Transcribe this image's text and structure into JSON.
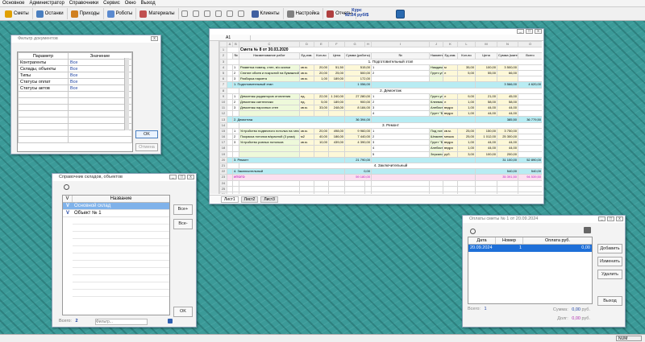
{
  "menu": [
    "Основное",
    "Администратор",
    "Справочники",
    "Сервис",
    "Окно",
    "Выход"
  ],
  "toolbar": [
    {
      "label": "Сметы",
      "icon": "star-icon",
      "color": "#e0a000"
    },
    {
      "label": "Останки",
      "icon": "table-icon",
      "color": "#4a7fc0"
    },
    {
      "label": "Приходы",
      "icon": "truck-icon",
      "color": "#d08020"
    },
    {
      "label": "Роботы",
      "icon": "robot-icon",
      "color": "#5a8ad0"
    },
    {
      "label": "Материалы",
      "icon": "palette-icon",
      "color": "#c05050"
    },
    {
      "label": "Клиенты",
      "icon": "clients-icon",
      "color": "#4060a0"
    },
    {
      "label": "Настройка",
      "icon": "tools-icon",
      "color": "#808080"
    },
    {
      "label": "Отчеты",
      "icon": "report-icon",
      "color": "#b04040"
    }
  ],
  "toolbar_small": [
    "cut-icon",
    "copy-icon",
    "paste-icon",
    "undo-icon",
    "redo-icon",
    "refresh-icon"
  ],
  "course": {
    "line1": "Курс",
    "line2": "92.24 руб/$"
  },
  "status": {
    "cell": "NUM"
  },
  "filter": {
    "title": "Фильтр документов",
    "headers": [
      "Параметр",
      "Значение"
    ],
    "rows": [
      [
        "Контрагенты",
        "Все"
      ],
      [
        "Склады, объекты",
        "Все"
      ],
      [
        "Типы",
        "Все"
      ],
      [
        "Статусы оплат",
        "Все"
      ],
      [
        "Статусы актов",
        "Все"
      ]
    ],
    "ok": "OK",
    "cancel": "Отмена"
  },
  "warehouses": {
    "title": "Справочник складов, объектов",
    "header_check": "V",
    "header_name": "Название",
    "rows": [
      {
        "check": "V",
        "name": "Основной склад",
        "selected": true
      },
      {
        "check": "V",
        "name": "Объект № 1",
        "selected": false
      }
    ],
    "btn_all_on": "Все+",
    "btn_all_off": "Все-",
    "btn_ok": "OK",
    "footer_label": "Всего:",
    "footer_count": "2",
    "search_placeholder": "Фильтр..."
  },
  "sheet": {
    "cell_ref": "A1",
    "col_letters": [
      "A",
      "B",
      "C",
      "D",
      "E",
      "F",
      "G",
      "H",
      "I",
      "J",
      "K",
      "L",
      "M",
      "N",
      "O"
    ],
    "title": "Смета № 8 от 30.03.2020",
    "headers": [
      "№",
      "Наименование работ",
      "Ед.изм.",
      "Кол-во",
      "Цена",
      "Сумма (работы)",
      "№",
      "Наименование материала",
      "Ед.изм.",
      "Кол-во",
      "Цена",
      "Сумма (материалы)",
      "Всего"
    ],
    "sections": [
      {
        "name": "1. Подготовительный этап",
        "rows": [
          [
            "1",
            "Разметка помещ. стен, в/з сколки",
            "кв.м.",
            "20,00",
            "51,50",
            "515,00",
            "1",
            "Наждачная бумага",
            "м",
            "35,00",
            "100,00",
            "3 500,00"
          ],
          [
            "2",
            "Снятие обоев и покрытий на бумажной основе",
            "кв.м.",
            "20,00",
            "25,00",
            "500,00",
            "2",
            "Грунт-универсал \"Кнауф Тифенгрунд\" (10л)",
            "л",
            "5,00",
            "55,00",
            "66,00"
          ],
          [
            "3",
            "Разборка паркета",
            "кв.м.",
            "1,00",
            "189,00",
            "172,00",
            "",
            "",
            "",
            "",
            "",
            ""
          ]
        ],
        "total": [
          "1. Подготовительный этап",
          "1 056,00",
          "3 566,00",
          "4 620,00"
        ]
      },
      {
        "name": "2. Демонтаж",
        "rows": [
          [
            "1",
            "Демонтаж радиаторов отопления",
            "ед.",
            "22,00",
            "1 240,00",
            "27 280,00",
            "1",
            "Грунт-универсал \"Кнауф Тифенгрунд\" (10л)",
            "л",
            "9,00",
            "21,00",
            "45,00"
          ],
          [
            "2",
            "Демонтаж сантехники",
            "ед.",
            "5,00",
            "189,00",
            "900,00",
            "2",
            "Клеевая побелка (в/д) \"Byfe Wandweiss\"",
            "л",
            "1,00",
            "58,00",
            "58,00"
          ],
          [
            "3",
            "Демонтаж нарочных стен",
            "кв.м.",
            "33,00",
            "248,00",
            "8 184,00",
            "3",
            "Алебастр 40 кг",
            "ведро",
            "1,00",
            "44,00",
            "44,00"
          ],
          [
            "",
            "",
            "",
            "",
            "",
            "",
            "4",
            "Грунт \"Бетон-контакт\" 5 кг",
            "ведро",
            "1,00",
            "44,00",
            "44,00"
          ]
        ],
        "total": [
          "2. Демонтаж",
          "36 394,00",
          "385,50",
          "36 779,50"
        ]
      },
      {
        "name": "3. Ремонт",
        "rows": [
          [
            "1",
            "Устройство подвесного потолка на гипс.",
            "кв.м.",
            "20,00",
            "498,00",
            "9 960,00",
            "1",
            "Под потолок \"Armstrong Oasis\" плиты",
            "кв.м.",
            "25,00",
            "150,00",
            "3 750,00"
          ],
          [
            "2",
            "Покраска потолка в/красной (3 раза)",
            "м2",
            "40,00",
            "186,00",
            "7 440,00",
            "2",
            "Шпаклевка \"Vetonit KR\" (25кг)",
            "мешок",
            "25,00",
            "1 012,00",
            "25 300,00"
          ],
          [
            "3",
            "Устройство ровных потолков",
            "кв.м.",
            "10,00",
            "439,00",
            "4 390,00",
            "3",
            "Грунт \"Бетон-контакт\" 5 кг",
            "ведро",
            "1,00",
            "44,00",
            "44,00"
          ],
          [
            "",
            "",
            "",
            "",
            "",
            "",
            "4",
            "Алебастр 40 кг",
            "ведро",
            "1,00",
            "44,00",
            "44,00"
          ],
          [
            "",
            "",
            "",
            "",
            "",
            "",
            "5",
            "Зеркало 20 мм",
            "руб.",
            "3,00",
            "100,00",
            "200,00"
          ]
        ],
        "total": [
          "3. Ремонт",
          "21 790,00",
          "31 100,00",
          "52 890,00"
        ]
      },
      {
        "name": "4. Заключительный",
        "rows": [],
        "total": [
          "4. Заключительный",
          "0,00",
          "540,00",
          "540,00"
        ]
      }
    ],
    "grand": [
      "ИТОГО",
      "59 180,00",
      "35 391,50",
      "94 539,50"
    ],
    "tabs": [
      "Лист1",
      "Лист2",
      "Лист3"
    ]
  },
  "payments": {
    "title": "Оплаты сметы № 1 от 20.09.2024",
    "headers": [
      "Дата",
      "Номер",
      "Оплата руб."
    ],
    "rows": [
      [
        "20.09.2024",
        "1",
        "0,00"
      ]
    ],
    "btn_add": "Добавить",
    "btn_edit": "Изменить",
    "btn_delete": "Удалить",
    "btn_exit": "Выход",
    "footer_label": "Всего:",
    "footer_count": "1",
    "sum_label": "Сумма:",
    "sum_value": "0,00",
    "sum_unit": "руб.",
    "debt_label": "Долг:",
    "debt_value": "0,00",
    "debt_unit": "руб."
  }
}
